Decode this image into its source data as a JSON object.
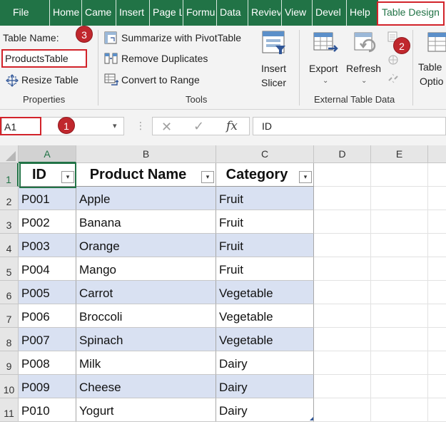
{
  "tabs": [
    {
      "label": "File"
    },
    {
      "label": "Home"
    },
    {
      "label": "Came"
    },
    {
      "label": "Insert"
    },
    {
      "label": "Page L"
    },
    {
      "label": "Formu"
    },
    {
      "label": "Data"
    },
    {
      "label": "Reviev"
    },
    {
      "label": "View"
    },
    {
      "label": "Devel"
    },
    {
      "label": "Help"
    },
    {
      "label": "Table Design",
      "active": true
    }
  ],
  "ribbon": {
    "properties": {
      "table_name_label": "Table Name:",
      "table_name_value": "ProductsTable",
      "resize_label": "Resize Table",
      "group_label": "Properties"
    },
    "tools": {
      "summarize_label": "Summarize with PivotTable",
      "remove_duplicates_label": "Remove Duplicates",
      "convert_label": "Convert to Range",
      "slicer_line1": "Insert",
      "slicer_line2": "Slicer",
      "group_label": "Tools"
    },
    "external": {
      "export_label": "Export",
      "refresh_label": "Refresh",
      "group_label": "External Table Data"
    },
    "options": {
      "line1": "Table",
      "line2": "Optio"
    }
  },
  "badges": {
    "one": "1",
    "two": "2",
    "three": "3"
  },
  "formula_bar": {
    "name_box": "A1",
    "cancel_glyph": "✕",
    "enter_glyph": "✓",
    "fx_glyph": "fx",
    "content": "ID"
  },
  "grid": {
    "columns": [
      "A",
      "B",
      "C",
      "D",
      "E"
    ],
    "rows": [
      "1",
      "2",
      "3",
      "4",
      "5",
      "6",
      "7",
      "8",
      "9",
      "10",
      "11"
    ],
    "headers": [
      "ID",
      "Product Name",
      "Category"
    ],
    "data": [
      [
        "P001",
        "Apple",
        "Fruit"
      ],
      [
        "P002",
        "Banana",
        "Fruit"
      ],
      [
        "P003",
        "Orange",
        "Fruit"
      ],
      [
        "P004",
        "Mango",
        "Fruit"
      ],
      [
        "P005",
        "Carrot",
        "Vegetable"
      ],
      [
        "P006",
        "Broccoli",
        "Vegetable"
      ],
      [
        "P007",
        "Spinach",
        "Vegetable"
      ],
      [
        "P008",
        "Milk",
        "Dairy"
      ],
      [
        "P009",
        "Cheese",
        "Dairy"
      ],
      [
        "P010",
        "Yogurt",
        "Dairy"
      ]
    ]
  },
  "colors": {
    "ribbon_green": "#217346",
    "band_blue": "#d9e1f2",
    "callout_red": "#d2232a"
  }
}
